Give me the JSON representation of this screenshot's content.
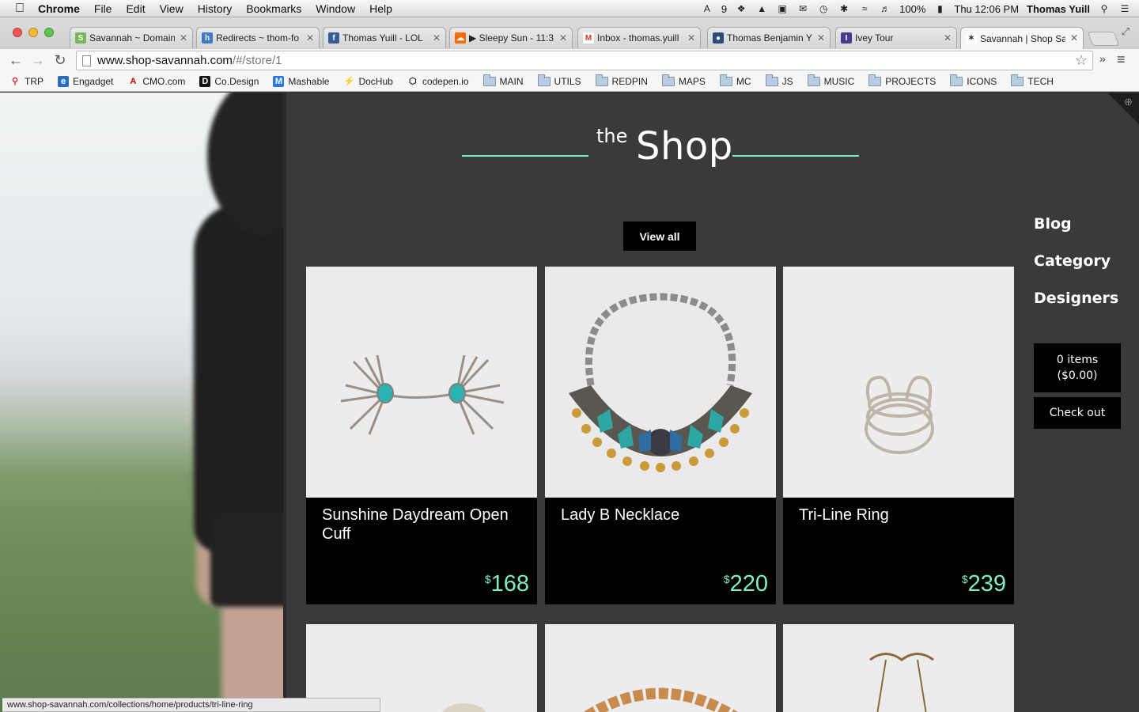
{
  "menubar": {
    "app": "Chrome",
    "items": [
      "File",
      "Edit",
      "View",
      "History",
      "Bookmarks",
      "Window",
      "Help"
    ],
    "tray": {
      "notifications": "9",
      "battery": "100%",
      "clock": "Thu 12:06 PM",
      "user": "Thomas Yuill"
    }
  },
  "tabs": [
    {
      "label": "Savannah ~ Domains",
      "favicon": "shopify-icon",
      "color": "#7ab55c"
    },
    {
      "label": "Redirects ~ thom-fo",
      "favicon": "hm-icon",
      "color": "#3e7bc4"
    },
    {
      "label": "Thomas Yuill - LOL",
      "favicon": "facebook-icon",
      "color": "#3b5998"
    },
    {
      "label": "▶ Sleepy Sun - 11:3",
      "favicon": "soundcloud-icon",
      "color": "#ff6a00"
    },
    {
      "label": "Inbox - thomas.yuill",
      "favicon": "gmail-icon",
      "color": "#d93025"
    },
    {
      "label": "Thomas Benjamin Y",
      "favicon": "profile-icon",
      "color": "#2b4d7a"
    },
    {
      "label": "Ivey Tour",
      "favicon": "ivey-icon",
      "color": "#4a3a8c"
    },
    {
      "label": "Savannah | Shop Sav",
      "favicon": "savannah-icon",
      "color": "#333333"
    }
  ],
  "address": {
    "host": "www.shop-savannah.com",
    "path": "/#/store/1"
  },
  "bookmarks": [
    {
      "label": "TRP",
      "icon": "pin-icon",
      "folder": false
    },
    {
      "label": "Engadget",
      "icon": "engadget-icon",
      "folder": false
    },
    {
      "label": "CMO.com",
      "icon": "adobe-icon",
      "folder": false
    },
    {
      "label": "Co.Design",
      "icon": "codesign-icon",
      "folder": false
    },
    {
      "label": "Mashable",
      "icon": "mashable-icon",
      "folder": false
    },
    {
      "label": "DocHub",
      "icon": "dochub-icon",
      "folder": false
    },
    {
      "label": "codepen.io",
      "icon": "codepen-icon",
      "folder": false
    },
    {
      "label": "MAIN",
      "icon": "folder-icon",
      "folder": true
    },
    {
      "label": "UTILS",
      "icon": "folder-icon",
      "folder": true
    },
    {
      "label": "REDPIN",
      "icon": "folder-icon",
      "folder": true
    },
    {
      "label": "MAPS",
      "icon": "folder-icon",
      "folder": true
    },
    {
      "label": "MC",
      "icon": "folder-icon",
      "folder": true
    },
    {
      "label": "JS",
      "icon": "folder-icon",
      "folder": true
    },
    {
      "label": "MUSIC",
      "icon": "folder-icon",
      "folder": true
    },
    {
      "label": "PROJECTS",
      "icon": "folder-icon",
      "folder": true
    },
    {
      "label": "ICONS",
      "icon": "folder-icon",
      "folder": true
    },
    {
      "label": "TECH",
      "icon": "folder-icon",
      "folder": true
    }
  ],
  "page": {
    "title_small": "the",
    "title_big": "Shop",
    "accent": "#7cf0c4",
    "view_all": "View all",
    "nav": [
      "Blog",
      "Category",
      "Designers"
    ],
    "cart": {
      "items": "0 items",
      "total": "($0.00)"
    },
    "checkout": "Check out",
    "currency": "$",
    "products": [
      {
        "name": "Sunshine Daydream Open Cuff",
        "price": "168"
      },
      {
        "name": "Lady B Necklace",
        "price": "220"
      },
      {
        "name": "Tri-Line Ring",
        "price": "239"
      }
    ]
  },
  "status_url": "www.shop-savannah.com/collections/home/products/tri-line-ring"
}
